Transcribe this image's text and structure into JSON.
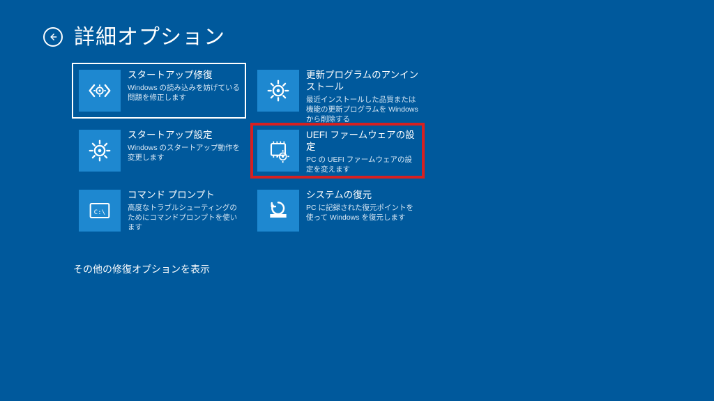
{
  "header": {
    "title": "詳細オプション"
  },
  "tiles": [
    {
      "id": "startup-repair",
      "title": "スタートアップ修復",
      "desc": "Windows の読み込みを妨げている問題を修正します",
      "icon": "code-brackets",
      "selected": true
    },
    {
      "id": "uninstall-updates",
      "title": "更新プログラムのアンインストール",
      "desc": "最近インストールした品質または機能の更新プログラムを Windows から削除する",
      "icon": "gear"
    },
    {
      "id": "startup-settings",
      "title": "スタートアップ設定",
      "desc": "Windows のスタートアップ動作を変更します",
      "icon": "gear"
    },
    {
      "id": "uefi-firmware",
      "title": "UEFI ファームウェアの設定",
      "desc": "PC の UEFI ファームウェアの設定を変えます",
      "icon": "chip-gear",
      "highlighted": true
    },
    {
      "id": "command-prompt",
      "title": "コマンド プロンプト",
      "desc": "高度なトラブルシューティングのためにコマンドプロンプトを使います",
      "icon": "terminal"
    },
    {
      "id": "system-restore",
      "title": "システムの復元",
      "desc": "PC に記録された復元ポイントを使って Windows を復元します",
      "icon": "restore"
    }
  ],
  "more_link": "その他の修復オプションを表示"
}
